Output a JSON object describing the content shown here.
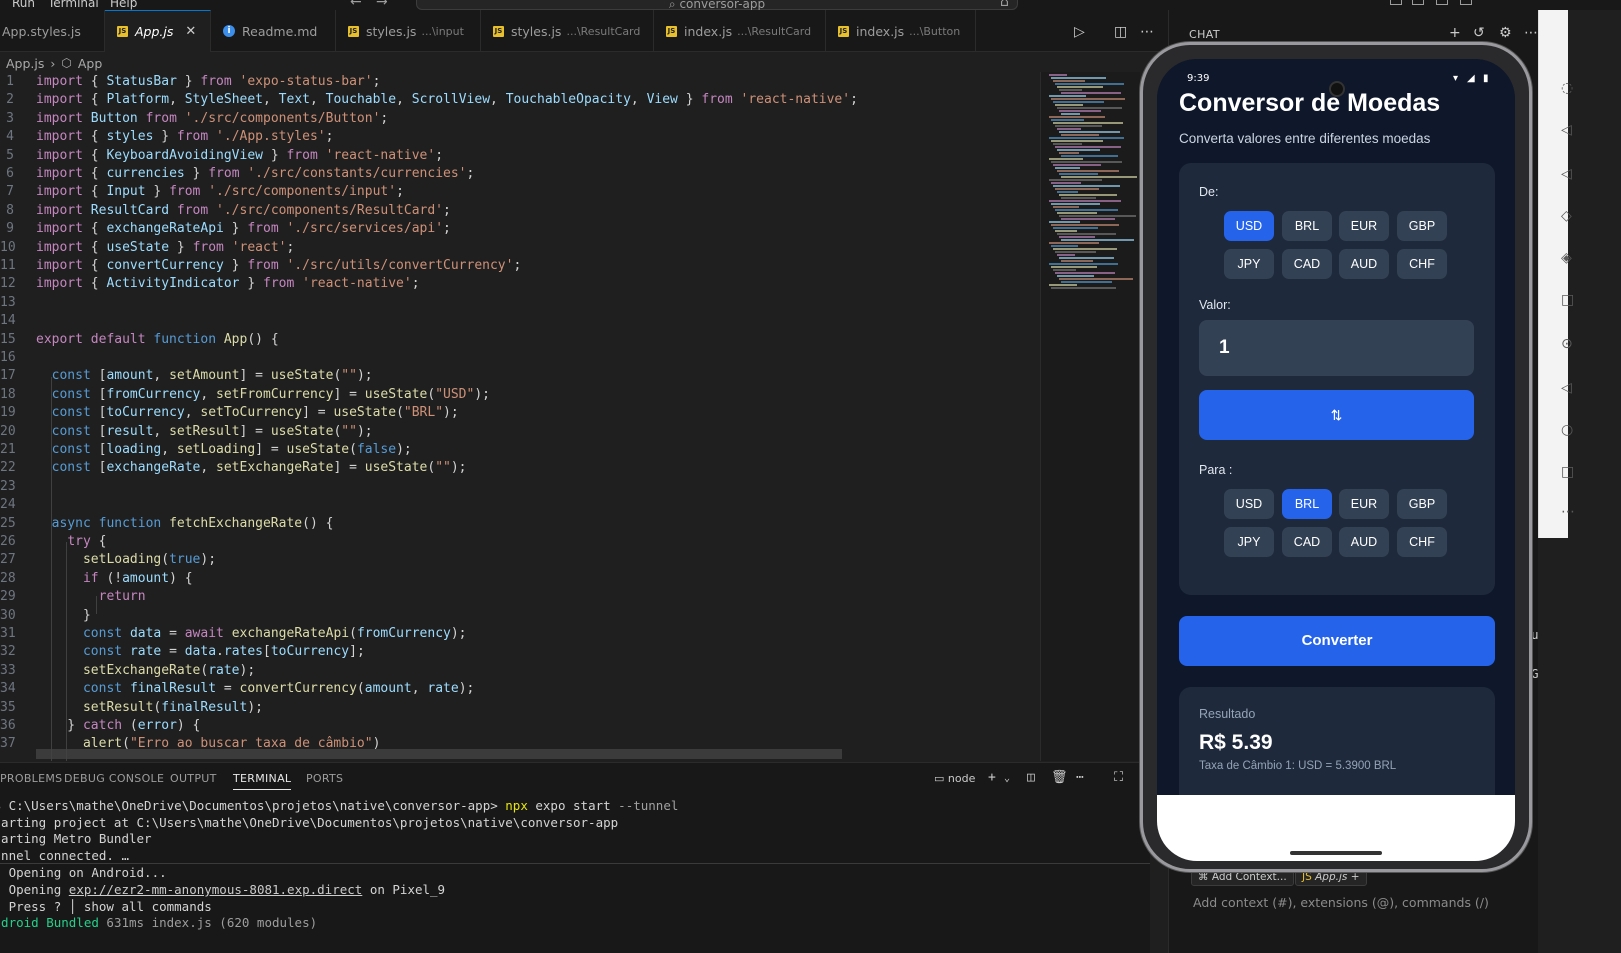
{
  "menubar": {
    "items": [
      "Run",
      "Terminal",
      "Help"
    ],
    "command_center": "conversor-app",
    "back_icon": "arrow-left-icon",
    "forward_icon": "arrow-right-icon"
  },
  "tabs": [
    {
      "label": "App.styles.js",
      "hint": "",
      "icon": "none",
      "active": false
    },
    {
      "label": "App.js",
      "hint": "",
      "icon": "js",
      "active": true
    },
    {
      "label": "Readme.md",
      "hint": "",
      "icon": "info",
      "active": false
    },
    {
      "label": "styles.js",
      "hint": "...\\input",
      "icon": "js",
      "active": false
    },
    {
      "label": "styles.js",
      "hint": "...\\ResultCard",
      "icon": "js",
      "active": false
    },
    {
      "label": "index.js",
      "hint": "...\\ResultCard",
      "icon": "js",
      "active": false
    },
    {
      "label": "index.js",
      "hint": "...\\Button",
      "icon": "js",
      "active": false
    }
  ],
  "tab_close_glyph": "✕",
  "breadcrumb": {
    "file": "App.js",
    "symbol": "App"
  },
  "editor_lines": [
    {
      "n": "1",
      "t": [
        [
          "k",
          "import"
        ],
        [
          "t",
          " { "
        ],
        [
          "v",
          "StatusBar"
        ],
        [
          "t",
          " } "
        ],
        [
          "k",
          "from"
        ],
        [
          "s",
          " 'expo-status-bar'"
        ],
        [
          "t",
          ";"
        ]
      ]
    },
    {
      "n": "2",
      "t": [
        [
          "k",
          "import"
        ],
        [
          "t",
          " { "
        ],
        [
          "v",
          "Platform"
        ],
        [
          "t",
          ", "
        ],
        [
          "v",
          "StyleSheet"
        ],
        [
          "t",
          ", "
        ],
        [
          "v",
          "Text"
        ],
        [
          "t",
          ", "
        ],
        [
          "v",
          "Touchable"
        ],
        [
          "t",
          ", "
        ],
        [
          "v",
          "ScrollView"
        ],
        [
          "t",
          ", "
        ],
        [
          "v",
          "TouchableOpacity"
        ],
        [
          "t",
          ", "
        ],
        [
          "v",
          "View"
        ],
        [
          "t",
          " } "
        ],
        [
          "k",
          "from"
        ],
        [
          "s",
          " 'react-native'"
        ],
        [
          "t",
          ";"
        ]
      ]
    },
    {
      "n": "3",
      "t": [
        [
          "k",
          "import"
        ],
        [
          "v",
          " Button "
        ],
        [
          "k",
          "from"
        ],
        [
          "s",
          " './src/components/Button'"
        ],
        [
          "t",
          ";"
        ]
      ]
    },
    {
      "n": "4",
      "t": [
        [
          "k",
          "import"
        ],
        [
          "t",
          " { "
        ],
        [
          "v",
          "styles"
        ],
        [
          "t",
          " } "
        ],
        [
          "k",
          "from"
        ],
        [
          "s",
          " './App.styles'"
        ],
        [
          "t",
          ";"
        ]
      ]
    },
    {
      "n": "5",
      "t": [
        [
          "k",
          "import"
        ],
        [
          "t",
          " { "
        ],
        [
          "v",
          "KeyboardAvoidingView"
        ],
        [
          "t",
          " } "
        ],
        [
          "k",
          "from"
        ],
        [
          "s",
          " 'react-native'"
        ],
        [
          "t",
          ";"
        ]
      ]
    },
    {
      "n": "6",
      "t": [
        [
          "k",
          "import"
        ],
        [
          "t",
          " { "
        ],
        [
          "v",
          "currencies"
        ],
        [
          "t",
          " } "
        ],
        [
          "k",
          "from"
        ],
        [
          "s",
          " './src/constants/currencies'"
        ],
        [
          "t",
          ";"
        ]
      ]
    },
    {
      "n": "7",
      "t": [
        [
          "k",
          "import"
        ],
        [
          "t",
          " { "
        ],
        [
          "v",
          "Input"
        ],
        [
          "t",
          " } "
        ],
        [
          "k",
          "from"
        ],
        [
          "s",
          " './src/components/input'"
        ],
        [
          "t",
          ";"
        ]
      ]
    },
    {
      "n": "8",
      "t": [
        [
          "k",
          "import"
        ],
        [
          "v",
          " ResultCard "
        ],
        [
          "k",
          "from"
        ],
        [
          "s",
          " './src/components/ResultCard'"
        ],
        [
          "t",
          ";"
        ]
      ]
    },
    {
      "n": "9",
      "t": [
        [
          "k",
          "import"
        ],
        [
          "t",
          " { "
        ],
        [
          "v",
          "exchangeRateApi"
        ],
        [
          "t",
          " } "
        ],
        [
          "k",
          "from"
        ],
        [
          "s",
          " './src/services/api'"
        ],
        [
          "t",
          ";"
        ]
      ]
    },
    {
      "n": "10",
      "t": [
        [
          "k",
          "import"
        ],
        [
          "t",
          " { "
        ],
        [
          "v",
          "useState"
        ],
        [
          "t",
          " } "
        ],
        [
          "k",
          "from"
        ],
        [
          "s",
          " 'react'"
        ],
        [
          "t",
          ";"
        ]
      ]
    },
    {
      "n": "11",
      "t": [
        [
          "k",
          "import"
        ],
        [
          "t",
          " { "
        ],
        [
          "v",
          "convertCurrency"
        ],
        [
          "t",
          " } "
        ],
        [
          "k",
          "from"
        ],
        [
          "s",
          " './src/utils/convertCurrency'"
        ],
        [
          "t",
          ";"
        ]
      ]
    },
    {
      "n": "12",
      "t": [
        [
          "k",
          "import"
        ],
        [
          "t",
          " { "
        ],
        [
          "v",
          "ActivityIndicator"
        ],
        [
          "t",
          " } "
        ],
        [
          "k",
          "from"
        ],
        [
          "s",
          " 'react-native'"
        ],
        [
          "t",
          ";"
        ]
      ]
    },
    {
      "n": "13",
      "t": []
    },
    {
      "n": "14",
      "t": []
    },
    {
      "n": "15",
      "t": [
        [
          "k",
          "export default "
        ],
        [
          "kb",
          "function "
        ],
        [
          "f",
          "App"
        ],
        [
          "t",
          "() {"
        ]
      ]
    },
    {
      "n": "16",
      "t": []
    },
    {
      "n": "17",
      "t": [
        [
          "t",
          "  "
        ],
        [
          "kb",
          "const "
        ],
        [
          "t",
          "["
        ],
        [
          "v",
          "amount"
        ],
        [
          "t",
          ", "
        ],
        [
          "f",
          "setAmount"
        ],
        [
          "t",
          "] = "
        ],
        [
          "f",
          "useState"
        ],
        [
          "t",
          "("
        ],
        [
          "s",
          "\"\""
        ],
        [
          "t",
          ");"
        ]
      ]
    },
    {
      "n": "18",
      "t": [
        [
          "t",
          "  "
        ],
        [
          "kb",
          "const "
        ],
        [
          "t",
          "["
        ],
        [
          "v",
          "fromCurrency"
        ],
        [
          "t",
          ", "
        ],
        [
          "f",
          "setFromCurrency"
        ],
        [
          "t",
          "] = "
        ],
        [
          "f",
          "useState"
        ],
        [
          "t",
          "("
        ],
        [
          "s",
          "\"USD\""
        ],
        [
          "t",
          ");"
        ]
      ]
    },
    {
      "n": "19",
      "t": [
        [
          "t",
          "  "
        ],
        [
          "kb",
          "const "
        ],
        [
          "t",
          "["
        ],
        [
          "v",
          "toCurrency"
        ],
        [
          "t",
          ", "
        ],
        [
          "f",
          "setToCurrency"
        ],
        [
          "t",
          "] = "
        ],
        [
          "f",
          "useState"
        ],
        [
          "t",
          "("
        ],
        [
          "s",
          "\"BRL\""
        ],
        [
          "t",
          ");"
        ]
      ]
    },
    {
      "n": "20",
      "t": [
        [
          "t",
          "  "
        ],
        [
          "kb",
          "const "
        ],
        [
          "t",
          "["
        ],
        [
          "v",
          "result"
        ],
        [
          "t",
          ", "
        ],
        [
          "f",
          "setResult"
        ],
        [
          "t",
          "] = "
        ],
        [
          "f",
          "useState"
        ],
        [
          "t",
          "("
        ],
        [
          "s",
          "\"\""
        ],
        [
          "t",
          ");"
        ]
      ]
    },
    {
      "n": "21",
      "t": [
        [
          "t",
          "  "
        ],
        [
          "kb",
          "const "
        ],
        [
          "t",
          "["
        ],
        [
          "v",
          "loading"
        ],
        [
          "t",
          ", "
        ],
        [
          "f",
          "setLoading"
        ],
        [
          "t",
          "] = "
        ],
        [
          "f",
          "useState"
        ],
        [
          "t",
          "("
        ],
        [
          "kb",
          "false"
        ],
        [
          "t",
          ");"
        ]
      ]
    },
    {
      "n": "22",
      "t": [
        [
          "t",
          "  "
        ],
        [
          "kb",
          "const "
        ],
        [
          "t",
          "["
        ],
        [
          "v",
          "exchangeRate"
        ],
        [
          "t",
          ", "
        ],
        [
          "f",
          "setExchangeRate"
        ],
        [
          "t",
          "] = "
        ],
        [
          "f",
          "useState"
        ],
        [
          "t",
          "("
        ],
        [
          "s",
          "\"\""
        ],
        [
          "t",
          ");"
        ]
      ]
    },
    {
      "n": "23",
      "t": []
    },
    {
      "n": "24",
      "t": []
    },
    {
      "n": "25",
      "t": [
        [
          "t",
          "  "
        ],
        [
          "kb",
          "async function "
        ],
        [
          "f",
          "fetchExchangeRate"
        ],
        [
          "t",
          "() {"
        ]
      ]
    },
    {
      "n": "26",
      "t": [
        [
          "t",
          "    "
        ],
        [
          "k",
          "try"
        ],
        [
          "t",
          " {"
        ]
      ]
    },
    {
      "n": "27",
      "t": [
        [
          "t",
          "      "
        ],
        [
          "f",
          "setLoading"
        ],
        [
          "t",
          "("
        ],
        [
          "kb",
          "true"
        ],
        [
          "t",
          ");"
        ]
      ]
    },
    {
      "n": "28",
      "t": [
        [
          "t",
          "      "
        ],
        [
          "k",
          "if"
        ],
        [
          "t",
          " (!"
        ],
        [
          "v",
          "amount"
        ],
        [
          "t",
          ") {"
        ]
      ]
    },
    {
      "n": "29",
      "t": [
        [
          "t",
          "        "
        ],
        [
          "k",
          "return"
        ]
      ]
    },
    {
      "n": "30",
      "t": [
        [
          "t",
          "      }"
        ]
      ]
    },
    {
      "n": "31",
      "t": [
        [
          "t",
          "      "
        ],
        [
          "kb",
          "const "
        ],
        [
          "v",
          "data"
        ],
        [
          "t",
          " = "
        ],
        [
          "k",
          "await "
        ],
        [
          "f",
          "exchangeRateApi"
        ],
        [
          "t",
          "("
        ],
        [
          "v",
          "fromCurrency"
        ],
        [
          "t",
          ");"
        ]
      ]
    },
    {
      "n": "32",
      "t": [
        [
          "t",
          "      "
        ],
        [
          "kb",
          "const "
        ],
        [
          "v",
          "rate"
        ],
        [
          "t",
          " = "
        ],
        [
          "v",
          "data"
        ],
        [
          "t",
          "."
        ],
        [
          "v",
          "rates"
        ],
        [
          "t",
          "["
        ],
        [
          "v",
          "toCurrency"
        ],
        [
          "t",
          "];"
        ]
      ]
    },
    {
      "n": "33",
      "t": [
        [
          "t",
          "      "
        ],
        [
          "f",
          "setExchangeRate"
        ],
        [
          "t",
          "("
        ],
        [
          "v",
          "rate"
        ],
        [
          "t",
          ");"
        ]
      ]
    },
    {
      "n": "34",
      "t": [
        [
          "t",
          "      "
        ],
        [
          "kb",
          "const "
        ],
        [
          "v",
          "finalResult"
        ],
        [
          "t",
          " = "
        ],
        [
          "f",
          "convertCurrency"
        ],
        [
          "t",
          "("
        ],
        [
          "v",
          "amount"
        ],
        [
          "t",
          ", "
        ],
        [
          "v",
          "rate"
        ],
        [
          "t",
          ");"
        ]
      ]
    },
    {
      "n": "35",
      "t": [
        [
          "t",
          "      "
        ],
        [
          "f",
          "setResult"
        ],
        [
          "t",
          "("
        ],
        [
          "v",
          "finalResult"
        ],
        [
          "t",
          ");"
        ]
      ]
    },
    {
      "n": "36",
      "t": [
        [
          "t",
          "    } "
        ],
        [
          "k",
          "catch"
        ],
        [
          "t",
          " ("
        ],
        [
          "v",
          "error"
        ],
        [
          "t",
          ") {"
        ]
      ]
    },
    {
      "n": "37",
      "t": [
        [
          "t",
          "      "
        ],
        [
          "f",
          "alert"
        ],
        [
          "t",
          "("
        ],
        [
          "s",
          "\"Erro ao buscar taxa de câmbio\""
        ],
        [
          "t",
          ")"
        ]
      ]
    }
  ],
  "panel": {
    "tabs": [
      "PROBLEMS",
      "DEBUG CONSOLE",
      "OUTPUT",
      "TERMINAL",
      "PORTS"
    ],
    "active_tab": "TERMINAL",
    "terminal_name": "node",
    "terminal_lines": [
      [
        [
          "t",
          "PS C:\\Users\\mathe\\OneDrive\\Documentos\\projetos\\native\\conversor-app> "
        ],
        [
          "cmd",
          "npx"
        ],
        [
          "t",
          " expo start "
        ],
        [
          "flag",
          "--tunnel"
        ]
      ],
      [
        [
          "t",
          "Starting project at C:\\Users\\mathe\\OneDrive\\Documentos\\projetos\\native\\conversor-app"
        ]
      ],
      [
        [
          "t",
          "Starting Metro Bundler"
        ]
      ],
      [
        [
          "t",
          "Tunnel connected. …"
        ]
      ],
      [
        [
          "t",
          " › Opening on Android..."
        ]
      ],
      [
        [
          "t",
          " › Opening "
        ],
        [
          "link",
          "exp://ezr2-mm-anonymous-8081.exp.direct"
        ],
        [
          "t",
          " on Pixel_9"
        ]
      ],
      [
        [
          "t",
          " › Press ? │ show all commands"
        ]
      ],
      [
        [
          "green",
          "Android Bundled"
        ],
        [
          "dim",
          " 631ms index.js (620 modules)"
        ]
      ]
    ]
  },
  "chat": {
    "title": "CHAT",
    "fragments": [
      "ualiza",
      "GBP, "
    ],
    "add_context": "Add Context...",
    "context_file": "App.js",
    "input_placeholder": "Add context (#), extensions (@), commands (/)"
  },
  "phone": {
    "status_time": "9:39",
    "title": "Conversor de Moedas",
    "subtitle": "Converta valores entre diferentes moedas",
    "from_label": "De:",
    "value_label": "Valor:",
    "to_label": "Para :",
    "currencies": [
      "USD",
      "BRL",
      "EUR",
      "GBP",
      "JPY",
      "CAD",
      "AUD",
      "CHF"
    ],
    "from_selected": "USD",
    "to_selected": "BRL",
    "amount": "1",
    "swap_label": "⇅",
    "convert_label": "Converter",
    "result_label": "Resultado",
    "result_value": "R$  5.39",
    "result_rate": "Taxa de Câmbio 1: USD = 5.3900 BRL"
  },
  "colors": {
    "accent": "#2563eb",
    "app_bg": "#0f172a",
    "card_bg": "#1e293b",
    "chip_bg": "#334155"
  }
}
